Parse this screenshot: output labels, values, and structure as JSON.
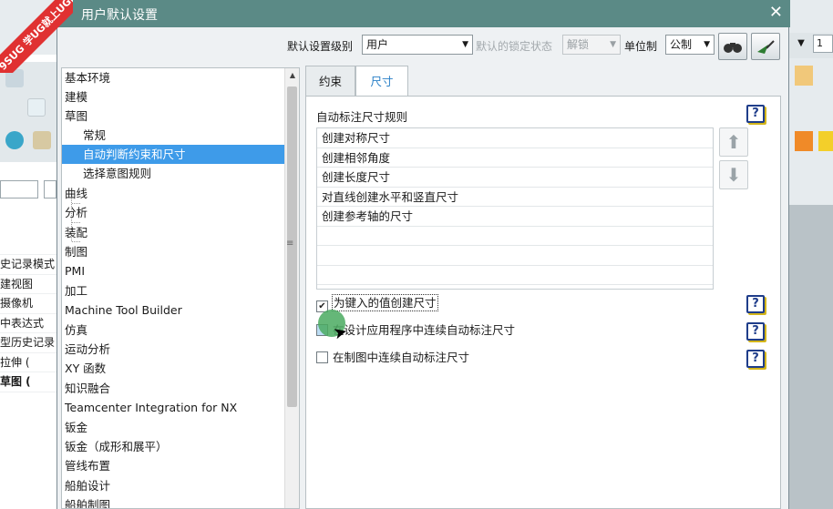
{
  "watermark": {
    "line1": "9SUG",
    "line2": "学UG就上UG网"
  },
  "background_app": {
    "list": [
      "史记录模式",
      "建视图",
      "摄像机",
      "中表达式",
      "型历史记录",
      "拉伸 (",
      "草图 ("
    ],
    "right_field": "1"
  },
  "dialog": {
    "title": "用户默认设置",
    "close_icon": "close-icon",
    "toolbar": {
      "level_label": "默认设置级别",
      "level_value": "用户",
      "lock_label": "默认的锁定状态",
      "lock_value": "解锁",
      "unit_label": "单位制",
      "unit_value": "公制"
    },
    "tree": {
      "items": [
        {
          "label": "基本环境"
        },
        {
          "label": "建模"
        },
        {
          "label": "草图"
        },
        {
          "label": "常规"
        },
        {
          "label": "自动判断约束和尺寸"
        },
        {
          "label": "选择意图规则"
        },
        {
          "label": "曲线"
        },
        {
          "label": "分析"
        },
        {
          "label": "装配"
        },
        {
          "label": "制图"
        },
        {
          "label": "PMI"
        },
        {
          "label": "加工"
        },
        {
          "label": "Machine Tool Builder"
        },
        {
          "label": "仿真"
        },
        {
          "label": "运动分析"
        },
        {
          "label": "XY 函数"
        },
        {
          "label": "知识融合"
        },
        {
          "label": "Teamcenter Integration for NX"
        },
        {
          "label": "钣金"
        },
        {
          "label": "钣金（成形和展平）"
        },
        {
          "label": "管线布置"
        },
        {
          "label": "船舶设计"
        },
        {
          "label": "船舶制图"
        }
      ],
      "selected": "自动判断约束和尺寸"
    },
    "tabs": [
      {
        "label": "约束",
        "active": false
      },
      {
        "label": "尺寸",
        "active": true
      }
    ],
    "content": {
      "section_label": "自动标注尺寸规则",
      "rules": [
        "创建对称尺寸",
        "创建相邻角度",
        "创建长度尺寸",
        "对直线创建水平和竖直尺寸",
        "创建参考轴的尺寸",
        "",
        "",
        ""
      ],
      "checkboxes": [
        {
          "label": "为键入的值创建尺寸",
          "checked": true
        },
        {
          "label": "在设计应用程序中连续自动标注尺寸",
          "checked": false
        },
        {
          "label": "在制图中连续自动标注尺寸",
          "checked": false
        }
      ],
      "help_glyph": "?"
    }
  },
  "colors": {
    "titlebar": "#5b8a86",
    "selection": "#3e9be9",
    "active_tab_text": "#2a80c7",
    "help_border": "#1f3d8a"
  }
}
